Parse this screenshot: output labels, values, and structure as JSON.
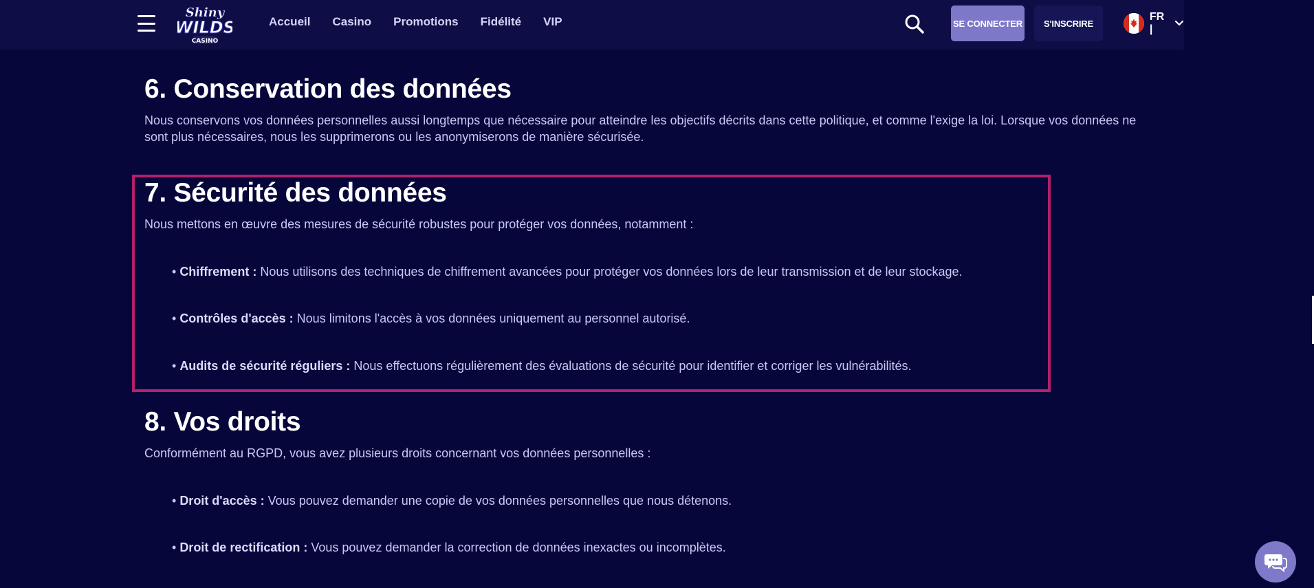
{
  "header": {
    "logo": {
      "line1": "Shiny",
      "line2": "WILDS",
      "line3": "CASINO"
    },
    "nav": [
      {
        "label": "Accueil"
      },
      {
        "label": "Casino"
      },
      {
        "label": "Promotions"
      },
      {
        "label": "Fidélité"
      },
      {
        "label": "VIP"
      }
    ],
    "login_label": "SE CONNECTER",
    "register_label": "S'INSCRIRE",
    "language": "FR |"
  },
  "sections": {
    "s6": {
      "title": "6. Conservation des données",
      "text": "Nous conservons vos données personnelles aussi longtemps que nécessaire pour atteindre les objectifs décrits dans cette politique, et comme l'exige la loi. Lorsque vos données ne sont plus nécessaires, nous les supprimerons ou les anonymiserons de manière sécurisée."
    },
    "s7": {
      "title": "7. Sécurité des données",
      "intro": "Nous mettons en œuvre des mesures de sécurité robustes pour protéger vos données, notamment :",
      "items": [
        {
          "term": "Chiffrement :",
          "text": "Nous utilisons des techniques de chiffrement avancées pour protéger vos données lors de leur transmission et de leur stockage."
        },
        {
          "term": "Contrôles d'accès :",
          "text": "Nous limitons l'accès à vos données uniquement au personnel autorisé."
        },
        {
          "term": "Audits de sécurité réguliers :",
          "text": "Nous effectuons régulièrement des évaluations de sécurité pour identifier et corriger les vulnérabilités."
        }
      ]
    },
    "s8": {
      "title": "8. Vos droits",
      "intro": "Conformément au RGPD, vous avez plusieurs droits concernant vos données personnelles :",
      "items": [
        {
          "term": "Droit d'accès :",
          "text": "Vous pouvez demander une copie de vos données personnelles que nous détenons."
        },
        {
          "term": "Droit de rectification :",
          "text": "Vous pouvez demander la correction de données inexactes ou incomplètes."
        }
      ]
    }
  },
  "colors": {
    "background": "#07063a",
    "header": "#0e0d45",
    "accent_button": "#7d78c8",
    "highlight_border": "#b3206b"
  },
  "icons": {
    "menu": "hamburger-icon",
    "search": "search-icon",
    "flag": "canada-flag-icon",
    "chevron": "chevron-down-icon",
    "chat": "chat-bubble-icon"
  }
}
